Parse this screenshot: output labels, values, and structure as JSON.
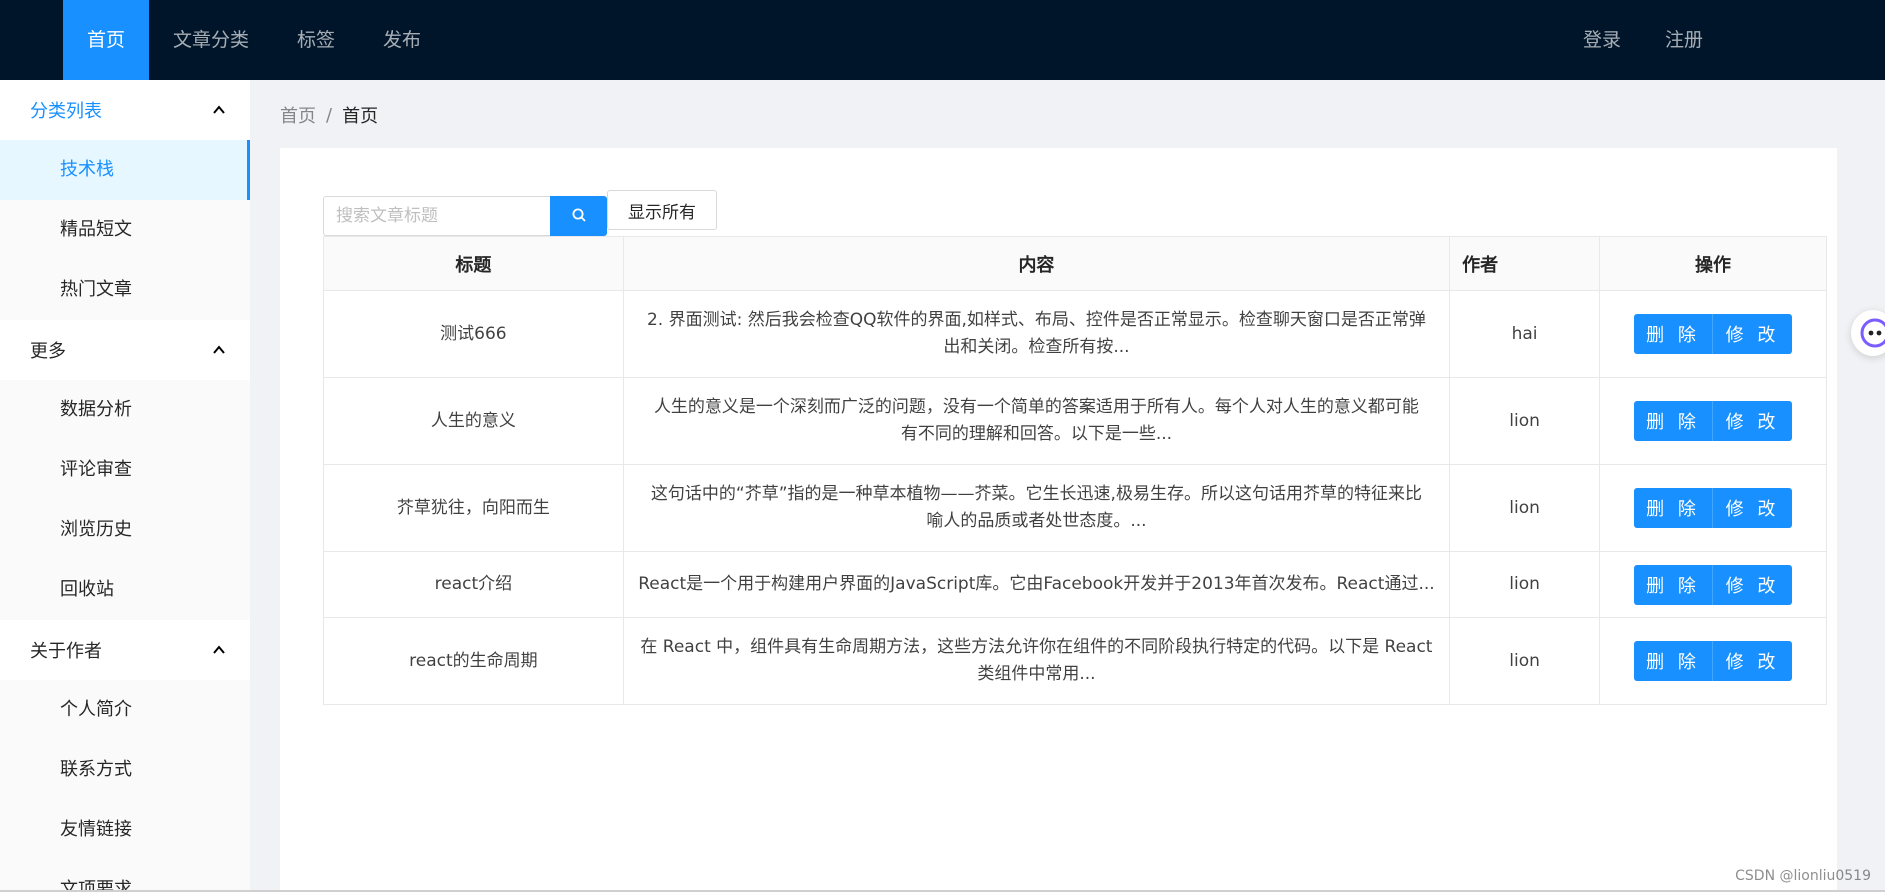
{
  "nav": {
    "items": [
      {
        "label": "首页",
        "active": true
      },
      {
        "label": "文章分类",
        "active": false
      },
      {
        "label": "标签",
        "active": false
      },
      {
        "label": "发布",
        "active": false
      }
    ],
    "login": "登录",
    "register": "注册"
  },
  "sidebar": {
    "groups": [
      {
        "title": "分类列表",
        "open": true,
        "items": [
          "技术栈",
          "精品短文",
          "热门文章"
        ]
      },
      {
        "title": "更多",
        "open": false,
        "items": [
          "数据分析",
          "评论审查",
          "浏览历史",
          "回收站"
        ]
      },
      {
        "title": "关于作者",
        "open": false,
        "items": [
          "个人简介",
          "联系方式",
          "友情链接",
          "文项要求"
        ]
      }
    ],
    "selected": "技术栈"
  },
  "breadcrumb": {
    "root": "首页",
    "separator": "/",
    "current": "首页"
  },
  "search": {
    "placeholder": "搜索文章标题",
    "value": "",
    "show_all": "显示所有"
  },
  "table": {
    "headers": {
      "title": "标题",
      "content": "内容",
      "author": "作者",
      "ops": "操作"
    },
    "delete_label": "删 除",
    "edit_label": "修 改",
    "rows": [
      {
        "title": "测试666",
        "content_line1": "2. 界面测试: 然后我会检查QQ软件的界面,如样式、布局、控件是否正常显示。检查聊天窗口是否正常弹",
        "content_line2": "出和关闭。检查所有按...",
        "author": "hai"
      },
      {
        "title": "人生的意义",
        "content_line1": "人生的意义是一个深刻而广泛的问题，没有一个简单的答案适用于所有人。每个人对人生的意义都可能",
        "content_line2": "有不同的理解和回答。以下是一些...",
        "author": "lion"
      },
      {
        "title": "芥草犹往，向阳而生",
        "content_line1": "这句话中的“芥草”指的是一种草本植物——芥菜。它生长迅速,极易生存。所以这句话用芥草的特征来比",
        "content_line2": "喻人的品质或者处世态度。...",
        "author": "lion"
      },
      {
        "title": "react介绍",
        "content_line1": "React是一个用于构建用户界面的JavaScript库。它由Facebook开发并于2013年首次发布。React通过...",
        "content_line2": "",
        "author": "lion"
      },
      {
        "title": "react的生命周期",
        "content_line1": "在 React 中，组件具有生命周期方法，这些方法允许你在组件的不同阶段执行特定的代码。以下是 React",
        "content_line2": "类组件中常用...",
        "author": "lion"
      }
    ]
  },
  "watermark": "CSDN @lionliu0519",
  "colors": {
    "primary": "#1890ff",
    "header_bg": "#001529",
    "page_bg": "#f0f2f5"
  }
}
